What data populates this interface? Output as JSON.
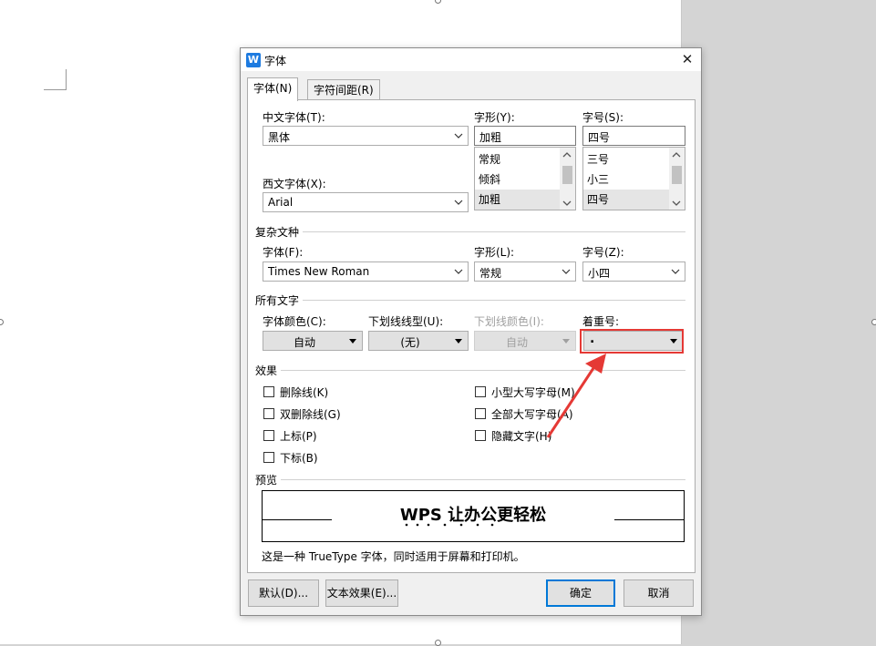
{
  "dialog": {
    "title": "字体",
    "app_icon_text": "W",
    "tabs": [
      {
        "label": "字体(N)",
        "active": true
      },
      {
        "label": "字符间距(R)",
        "active": false
      }
    ]
  },
  "cjk_font": {
    "label": "中文字体(T):",
    "value": "黑体"
  },
  "western_font": {
    "label": "西文字体(X):",
    "value": "Arial"
  },
  "style": {
    "label": "字形(Y):",
    "value": "加粗",
    "options": [
      "常规",
      "倾斜",
      "加粗"
    ],
    "selected": "加粗"
  },
  "size": {
    "label": "字号(S):",
    "value": "四号",
    "options": [
      "三号",
      "小三",
      "四号"
    ],
    "selected": "四号"
  },
  "complex_script": {
    "section": "复杂文种",
    "font_label": "字体(F):",
    "font_value": "Times New Roman",
    "style_label": "字形(L):",
    "style_value": "常规",
    "size_label": "字号(Z):",
    "size_value": "小四"
  },
  "all_text": {
    "section": "所有文字",
    "font_color_label": "字体颜色(C):",
    "font_color_value": "自动",
    "underline_label": "下划线线型(U):",
    "underline_value": "(无)",
    "underline_color_label": "下划线颜色(I):",
    "underline_color_value": "自动",
    "emphasis_label": "着重号:",
    "emphasis_value": "."
  },
  "effects": {
    "section": "效果",
    "left": [
      "删除线(K)",
      "双删除线(G)",
      "上标(P)",
      "下标(B)"
    ],
    "right": [
      "小型大写字母(M)",
      "全部大写字母(A)",
      "隐藏文字(H)"
    ]
  },
  "preview": {
    "section": "预览",
    "sample": "WPS 让办公更轻松",
    "note": "这是一种 TrueType 字体，同时适用于屏幕和打印机。"
  },
  "buttons": {
    "default": "默认(D)...",
    "text_effects": "文本效果(E)...",
    "ok": "确定",
    "cancel": "取消"
  },
  "colors": {
    "accent": "#0078d7",
    "annotation": "#e53935",
    "wps_icon": "#1e7be0"
  }
}
